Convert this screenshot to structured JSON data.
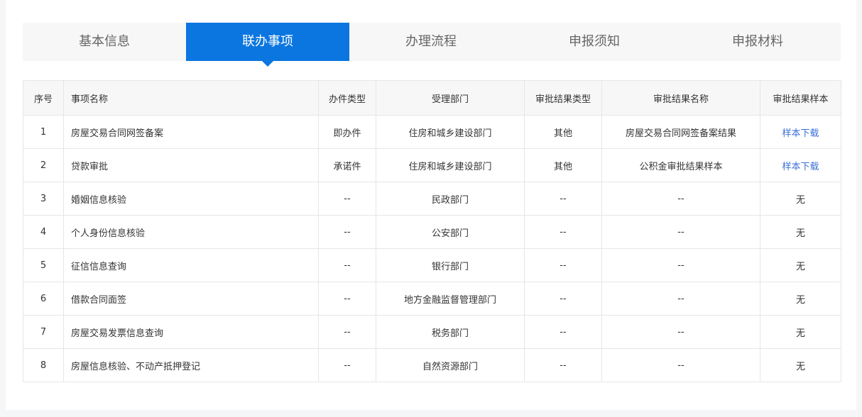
{
  "tabs": [
    {
      "label": "基本信息",
      "active": false
    },
    {
      "label": "联办事项",
      "active": true
    },
    {
      "label": "办理流程",
      "active": false
    },
    {
      "label": "申报须知",
      "active": false
    },
    {
      "label": "申报材料",
      "active": false
    }
  ],
  "table": {
    "headers": [
      "序号",
      "事项名称",
      "办件类型",
      "受理部门",
      "审批结果类型",
      "审批结果名称",
      "审批结果样本"
    ],
    "rows": [
      {
        "no": "1",
        "name": "房屋交易合同网签备案",
        "type": "即办件",
        "dept": "住房和城乡建设部门",
        "result_type": "其他",
        "result_name": "房屋交易合同网签备案结果",
        "sample": "样本下载"
      },
      {
        "no": "2",
        "name": "贷款审批",
        "type": "承诺件",
        "dept": "住房和城乡建设部门",
        "result_type": "其他",
        "result_name": "公积金审批结果样本",
        "sample": "样本下载"
      },
      {
        "no": "3",
        "name": "婚姻信息核验",
        "type": "--",
        "dept": "民政部门",
        "result_type": "--",
        "result_name": "--",
        "sample": "无"
      },
      {
        "no": "4",
        "name": "个人身份信息核验",
        "type": "--",
        "dept": "公安部门",
        "result_type": "--",
        "result_name": "--",
        "sample": "无"
      },
      {
        "no": "5",
        "name": "征信信息查询",
        "type": "--",
        "dept": "银行部门",
        "result_type": "--",
        "result_name": "--",
        "sample": "无"
      },
      {
        "no": "6",
        "name": "借款合同面签",
        "type": "--",
        "dept": "地方金融监督管理部门",
        "result_type": "--",
        "result_name": "--",
        "sample": "无"
      },
      {
        "no": "7",
        "name": "房屋交易发票信息查询",
        "type": "--",
        "dept": "税务部门",
        "result_type": "--",
        "result_name": "--",
        "sample": "无"
      },
      {
        "no": "8",
        "name": "房屋信息核验、不动产抵押登记",
        "type": "--",
        "dept": "自然资源部门",
        "result_type": "--",
        "result_name": "--",
        "sample": "无"
      }
    ]
  },
  "colors": {
    "accent": "#0b76e0",
    "link": "#3b6fd8"
  }
}
